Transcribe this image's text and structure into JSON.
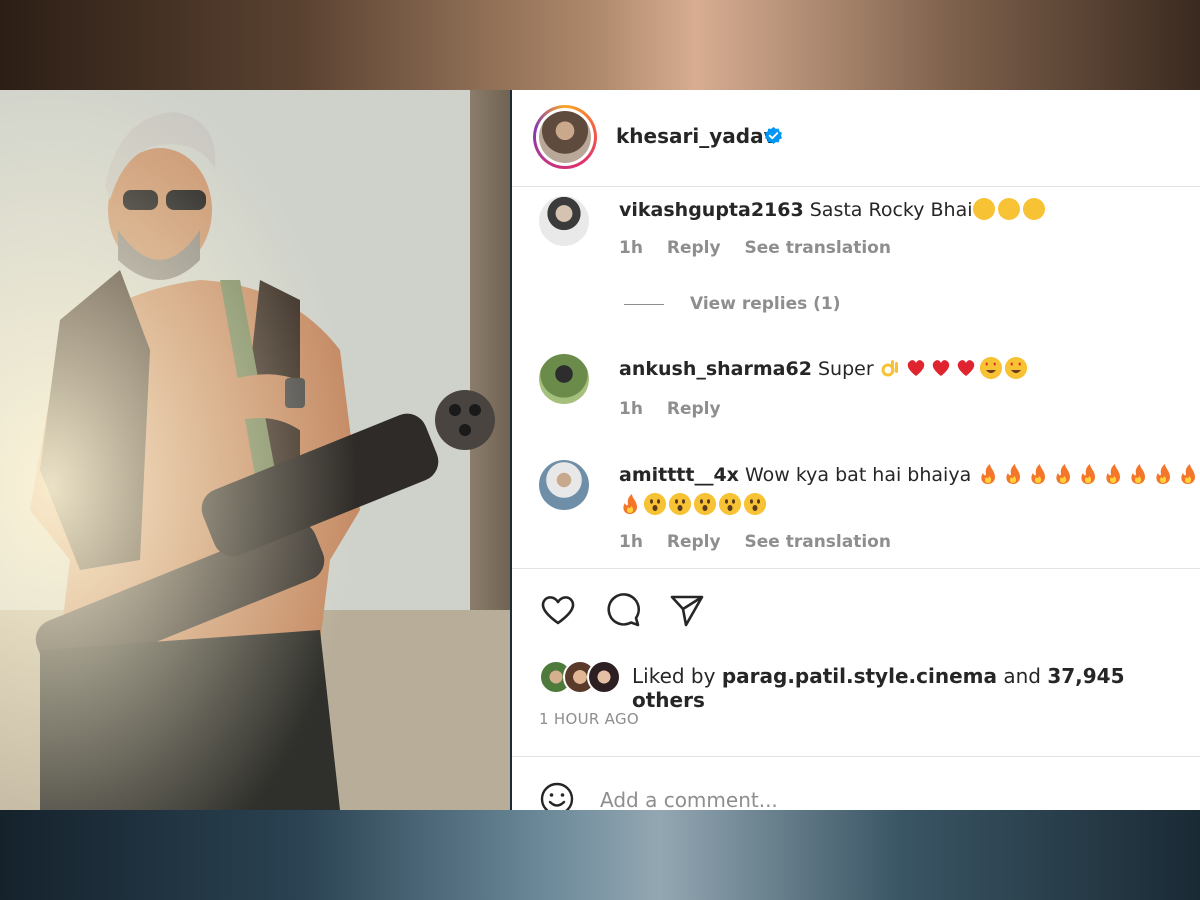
{
  "post": {
    "username": "khesari_yadav",
    "verified_icon": "verified-badge-icon",
    "accent_color": "#0095f6"
  },
  "comments": [
    {
      "user": "vikashgupta2163",
      "text": "Sasta Rocky Bhai",
      "emojis": [
        "laughing-emoji",
        "laughing-emoji",
        "laughing-emoji"
      ],
      "time": "1h",
      "reply": "Reply",
      "translation": "See translation"
    },
    {
      "user": "ankush_sharma62",
      "text": "Super",
      "emojis": [
        "ok-hand-emoji",
        "heart-emoji",
        "heart-emoji",
        "heart-emoji",
        "heart-eyes-emoji",
        "heart-eyes-emoji"
      ],
      "time": "1h",
      "reply": "Reply"
    },
    {
      "user": "amitttt__4x",
      "text": "Wow kya bat hai bhaiya",
      "emojis": [
        "fire-emoji",
        "fire-emoji",
        "fire-emoji",
        "fire-emoji",
        "fire-emoji",
        "fire-emoji",
        "fire-emoji",
        "fire-emoji",
        "fire-emoji",
        "fire-emoji",
        "wow-emoji",
        "wow-emoji",
        "wow-emoji",
        "wow-emoji",
        "wow-emoji"
      ],
      "time": "1h",
      "reply": "Reply",
      "translation": "See translation"
    }
  ],
  "view_replies": "View replies (1)",
  "actions": {
    "like_icon": "heart-outline-icon",
    "comment_icon": "comment-bubble-icon",
    "share_icon": "send-paper-plane-icon"
  },
  "likes": {
    "prefix": "Liked by",
    "user": "parag.patil.style.cinema",
    "middle": "and",
    "count": "37,945 others"
  },
  "timestamp": "1 HOUR AGO",
  "add_comment": {
    "placeholder": "Add a comment...",
    "emoji_icon": "smiley-face-icon"
  }
}
